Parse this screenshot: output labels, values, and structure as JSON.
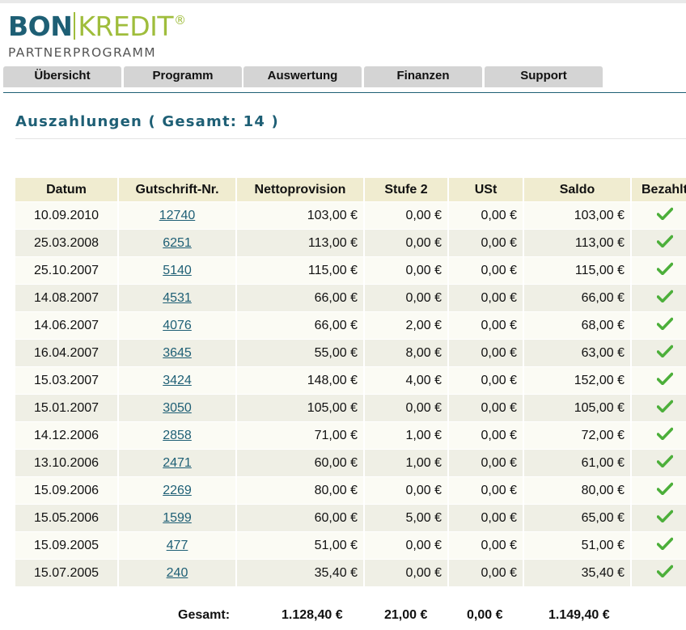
{
  "brand": {
    "name_left": "BON",
    "name_right": "KREDIT",
    "registered": "®",
    "subtitle": "PARTNERPROGRAMM"
  },
  "nav": {
    "tabs": [
      "Übersicht",
      "Programm",
      "Auswertung",
      "Finanzen",
      "Support"
    ]
  },
  "page": {
    "title": "Auszahlungen ( Gesamt: 14 )"
  },
  "table": {
    "headers": [
      "Datum",
      "Gutschrift-Nr.",
      "Nettoprovision",
      "Stufe 2",
      "USt",
      "Saldo",
      "Bezahlt"
    ],
    "rows": [
      {
        "datum": "10.09.2010",
        "nr": "12740",
        "netto": "103,00 €",
        "stufe2": "0,00 €",
        "ust": "0,00 €",
        "saldo": "103,00 €",
        "paid": true
      },
      {
        "datum": "25.03.2008",
        "nr": "6251",
        "netto": "113,00 €",
        "stufe2": "0,00 €",
        "ust": "0,00 €",
        "saldo": "113,00 €",
        "paid": true
      },
      {
        "datum": "25.10.2007",
        "nr": "5140",
        "netto": "115,00 €",
        "stufe2": "0,00 €",
        "ust": "0,00 €",
        "saldo": "115,00 €",
        "paid": true
      },
      {
        "datum": "14.08.2007",
        "nr": "4531",
        "netto": "66,00 €",
        "stufe2": "0,00 €",
        "ust": "0,00 €",
        "saldo": "66,00 €",
        "paid": true
      },
      {
        "datum": "14.06.2007",
        "nr": "4076",
        "netto": "66,00 €",
        "stufe2": "2,00 €",
        "ust": "0,00 €",
        "saldo": "68,00 €",
        "paid": true
      },
      {
        "datum": "16.04.2007",
        "nr": "3645",
        "netto": "55,00 €",
        "stufe2": "8,00 €",
        "ust": "0,00 €",
        "saldo": "63,00 €",
        "paid": true
      },
      {
        "datum": "15.03.2007",
        "nr": "3424",
        "netto": "148,00 €",
        "stufe2": "4,00 €",
        "ust": "0,00 €",
        "saldo": "152,00 €",
        "paid": true
      },
      {
        "datum": "15.01.2007",
        "nr": "3050",
        "netto": "105,00 €",
        "stufe2": "0,00 €",
        "ust": "0,00 €",
        "saldo": "105,00 €",
        "paid": true
      },
      {
        "datum": "14.12.2006",
        "nr": "2858",
        "netto": "71,00 €",
        "stufe2": "1,00 €",
        "ust": "0,00 €",
        "saldo": "72,00 €",
        "paid": true
      },
      {
        "datum": "13.10.2006",
        "nr": "2471",
        "netto": "60,00 €",
        "stufe2": "1,00 €",
        "ust": "0,00 €",
        "saldo": "61,00 €",
        "paid": true
      },
      {
        "datum": "15.09.2006",
        "nr": "2269",
        "netto": "80,00 €",
        "stufe2": "0,00 €",
        "ust": "0,00 €",
        "saldo": "80,00 €",
        "paid": true
      },
      {
        "datum": "15.05.2006",
        "nr": "1599",
        "netto": "60,00 €",
        "stufe2": "5,00 €",
        "ust": "0,00 €",
        "saldo": "65,00 €",
        "paid": true
      },
      {
        "datum": "15.09.2005",
        "nr": "477",
        "netto": "51,00 €",
        "stufe2": "0,00 €",
        "ust": "0,00 €",
        "saldo": "51,00 €",
        "paid": true
      },
      {
        "datum": "15.07.2005",
        "nr": "240",
        "netto": "35,40 €",
        "stufe2": "0,00 €",
        "ust": "0,00 €",
        "saldo": "35,40 €",
        "paid": true
      }
    ],
    "paid_icon": "green-checkmark-icon"
  },
  "totals": {
    "label": "Gesamt:",
    "netto": "1.128,40 €",
    "stufe2": "21,00 €",
    "ust": "0,00 €",
    "saldo": "1.149,40 €"
  },
  "colors": {
    "brand_blue": "#1e5f75",
    "brand_green": "#9fbd3c",
    "tab_bg": "#d4d4d4",
    "header_bg": "#f0ecd0",
    "check_green": "#4caf3a"
  }
}
